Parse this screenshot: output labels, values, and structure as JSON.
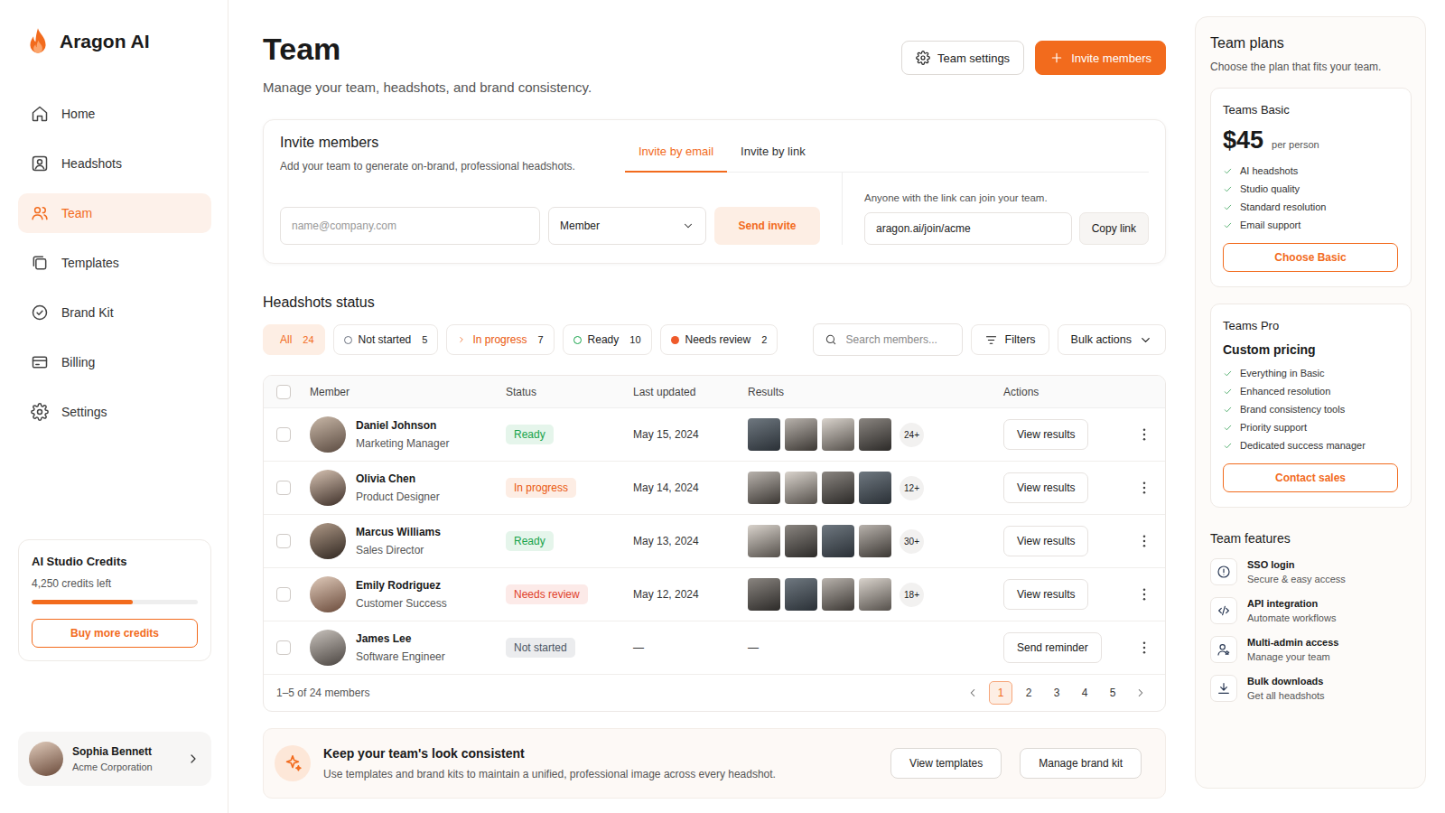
{
  "brand": {
    "name": "Aragon AI"
  },
  "nav": [
    {
      "label": "Home",
      "selected": false
    },
    {
      "label": "Headshots",
      "selected": false
    },
    {
      "label": "Team",
      "selected": true
    },
    {
      "label": "Templates",
      "selected": false
    },
    {
      "label": "Brand Kit",
      "selected": false
    },
    {
      "label": "Billing",
      "selected": false
    },
    {
      "label": "Settings",
      "selected": false
    }
  ],
  "credits": {
    "title": "AI Studio Credits",
    "reading": "4,250 credits left",
    "level": 0.61,
    "button": "Buy more credits"
  },
  "user": {
    "name": "Sophia Bennett",
    "org": "Acme Corporation"
  },
  "header": {
    "title": "Team",
    "subtitle": "Manage your team, headshots, and brand consistency.",
    "settings": "Team settings",
    "invite": "Invite members"
  },
  "invite": {
    "title": "Invite members",
    "subtitle": "Add your team to generate on-brand, professional headshots.",
    "tabs": [
      {
        "label": "Invite by email",
        "selected": true
      },
      {
        "label": "Invite by link",
        "selected": false
      }
    ],
    "email_placeholder": "name@company.com",
    "role": "Member",
    "send": "Send invite",
    "link_note": "Anyone with the link can join your team.",
    "link": "aragon.ai/join/acme",
    "copy": "Copy link"
  },
  "status": {
    "title": "Headshots status",
    "chips": [
      {
        "label": "All",
        "count": "24",
        "selected": true,
        "kind": "plain",
        "color": "#f26b1d"
      },
      {
        "label": "Not started",
        "count": "5",
        "selected": false,
        "kind": "ring",
        "color": "#6b7280"
      },
      {
        "label": "In progress",
        "count": "7",
        "selected": false,
        "kind": "chevron",
        "color": "#ea580c"
      },
      {
        "label": "Ready",
        "count": "10",
        "selected": false,
        "kind": "ring",
        "color": "#16a34a"
      },
      {
        "label": "Needs review",
        "count": "2",
        "selected": false,
        "kind": "dot",
        "color": "#ef5a2a"
      }
    ],
    "search_placeholder": "Search members...",
    "filters": "Filters",
    "bulk": "Bulk actions"
  },
  "table": {
    "select_all": {
      "checked": false
    },
    "columns": [
      "Member",
      "Status",
      "Last updated",
      "Results",
      "Actions"
    ],
    "rows": [
      {
        "name": "Daniel Johnson",
        "role": "Marketing Manager",
        "status": "Ready",
        "color": "#16a34a",
        "updated": "May 15, 2024",
        "kind": "done",
        "results": "24+",
        "action": "View results",
        "checked": false
      },
      {
        "name": "Olivia Chen",
        "role": "Product Designer",
        "status": "In progress",
        "color": "#ea580c",
        "updated": "May 14, 2024",
        "kind": "done",
        "results": "12+",
        "action": "View results",
        "checked": false
      },
      {
        "name": "Marcus Williams",
        "role": "Sales Director",
        "status": "Ready",
        "color": "#16a34a",
        "updated": "May 13, 2024",
        "kind": "done",
        "results": "30+",
        "action": "View results",
        "checked": false
      },
      {
        "name": "Emily Rodriguez",
        "role": "Customer Success",
        "status": "Needs review",
        "color": "#e0412b",
        "updated": "May 12, 2024",
        "kind": "done",
        "results": "18+",
        "action": "View results",
        "checked": false
      },
      {
        "name": "James Lee",
        "role": "Software Engineer",
        "status": "Not started",
        "color": "#4b5563",
        "updated": "—",
        "kind": "pending",
        "results": "—",
        "action": "Send reminder",
        "checked": false
      }
    ],
    "summary": "1–5 of 24 members",
    "pages": [
      {
        "label": "1",
        "selected": true
      },
      {
        "label": "2",
        "selected": false
      },
      {
        "label": "3",
        "selected": false
      },
      {
        "label": "4",
        "selected": false
      },
      {
        "label": "5",
        "selected": false
      }
    ]
  },
  "banner": {
    "title": "Keep your team's look consistent",
    "text": "Use templates and brand kits to maintain a unified, professional image across every headshot.",
    "buttons": [
      "View templates",
      "Manage brand kit"
    ]
  },
  "plans": {
    "title": "Team plans",
    "subtitle": "Choose the plan that fits your team.",
    "items": [
      {
        "name": "Teams Basic",
        "kind": "price",
        "price": "$45",
        "unit": "per person",
        "features": [
          "AI headshots",
          "Studio quality",
          "Standard resolution",
          "Email support"
        ],
        "button": "Choose Basic"
      },
      {
        "name": "Teams Pro",
        "kind": "custom",
        "price": "Custom pricing",
        "features": [
          "Everything in Basic",
          "Enhanced resolution",
          "Brand consistency tools",
          "Priority support",
          "Dedicated success manager"
        ],
        "button": "Contact sales"
      }
    ]
  },
  "features": {
    "title": "Team features",
    "items": [
      {
        "title": "SSO login",
        "text": "Secure & easy access"
      },
      {
        "title": "API integration",
        "text": "Automate workflows"
      },
      {
        "title": "Multi-admin access",
        "text": "Manage your team"
      },
      {
        "title": "Bulk downloads",
        "text": "Get all headshots"
      }
    ]
  }
}
